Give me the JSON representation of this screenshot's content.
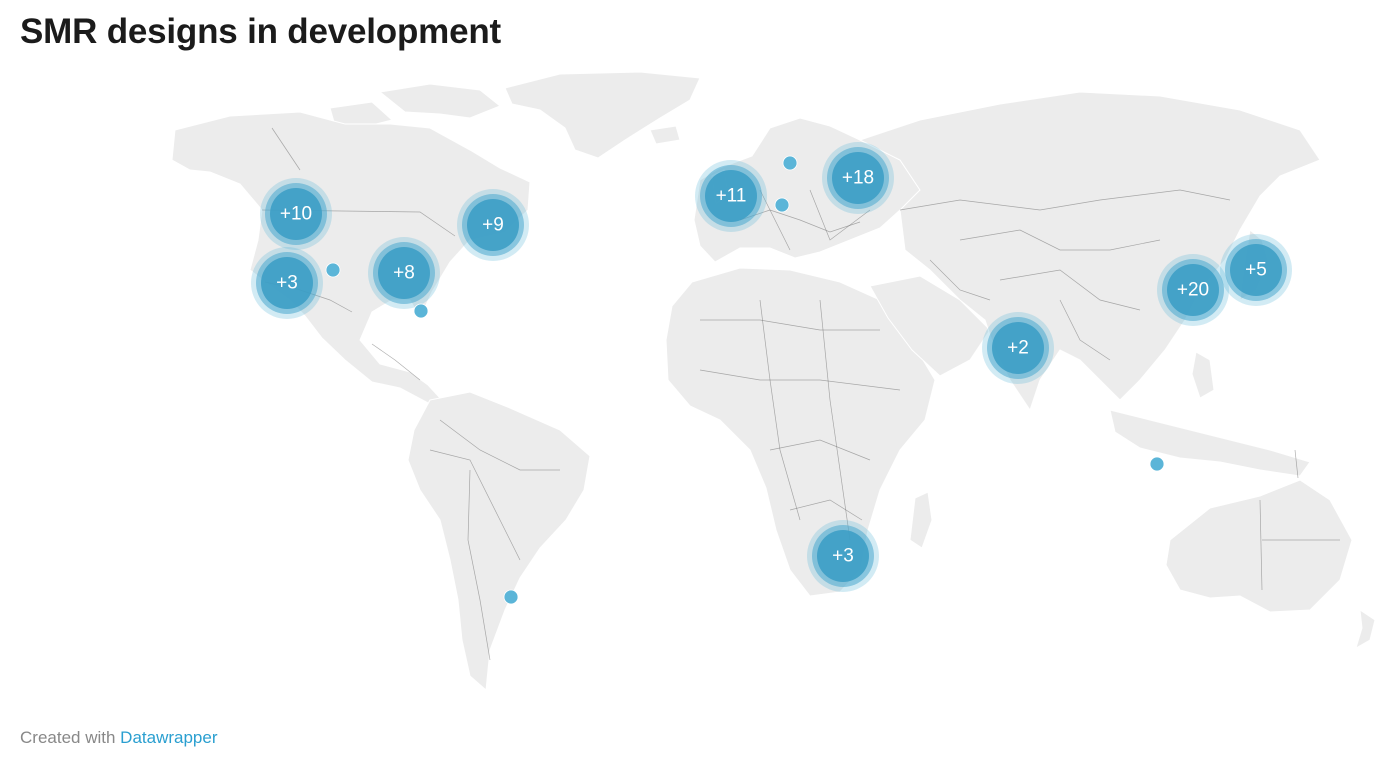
{
  "title": "SMR designs in development",
  "footer": {
    "prefix": "Created with",
    "link_text": "Datawrapper"
  },
  "colors": {
    "land": "#ececec",
    "cluster": "#3a9cc4",
    "dot": "#5bb5d8",
    "link": "#2a9fd0"
  },
  "clusters": [
    {
      "label": "+10",
      "region": "western-north-america"
    },
    {
      "label": "+3",
      "region": "california"
    },
    {
      "label": "+8",
      "region": "eastern-united-states"
    },
    {
      "label": "+9",
      "region": "eastern-canada"
    },
    {
      "label": "+11",
      "region": "western-europe"
    },
    {
      "label": "+18",
      "region": "eastern-europe-russia"
    },
    {
      "label": "+2",
      "region": "india"
    },
    {
      "label": "+20",
      "region": "china"
    },
    {
      "label": "+5",
      "region": "japan-korea"
    },
    {
      "label": "+3",
      "region": "southern-africa"
    }
  ],
  "single_markers": [
    {
      "region": "central-united-states"
    },
    {
      "region": "florida"
    },
    {
      "region": "sweden"
    },
    {
      "region": "central-europe"
    },
    {
      "region": "indonesia"
    },
    {
      "region": "argentina"
    }
  ]
}
